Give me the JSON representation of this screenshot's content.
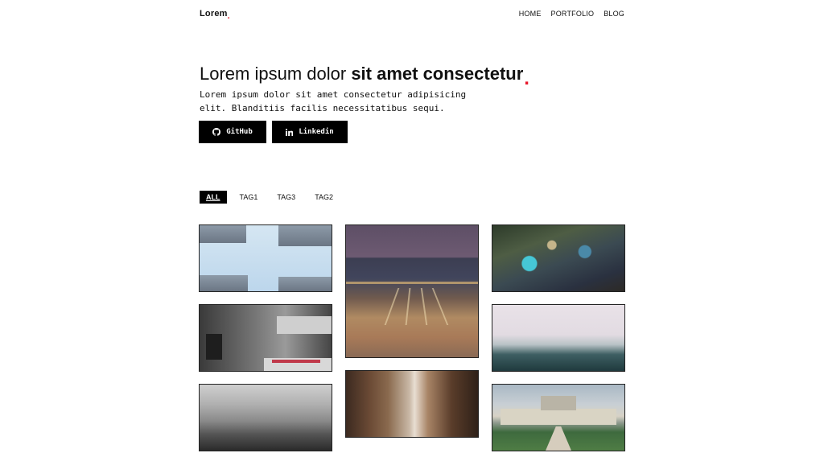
{
  "nav": {
    "brand": "Lorem.",
    "brand_text": "Lorem",
    "brand_dot": ".",
    "items": [
      "HOME",
      "PORTFOLIO",
      "BLOG"
    ]
  },
  "hero": {
    "title_regular": "Lorem ipsum dolor ",
    "title_bold": "sit amet consectetur",
    "title_dot": ".",
    "subtitle": "Lorem ipsum dolor sit amet consectetur adipisicing elit. Blanditiis facilis necessitatibus sequi.",
    "buttons": [
      {
        "label": "GitHub",
        "icon": "github-icon"
      },
      {
        "label": "Linkedin",
        "icon": "linkedin-icon"
      }
    ]
  },
  "filters": {
    "tags": [
      "ALL",
      "TAG1",
      "TAG3",
      "TAG2"
    ],
    "active": "ALL"
  },
  "gallery": {
    "photos": [
      {
        "subject": "skyscrapers-looking-up"
      },
      {
        "subject": "railway-night-city"
      },
      {
        "subject": "floating-market"
      },
      {
        "subject": "old-building-with-car"
      },
      {
        "subject": "misty-forest-coast"
      },
      {
        "subject": "fire-escapes-alley"
      },
      {
        "subject": "foggy-forest-bw"
      },
      {
        "subject": "chateau-avenue"
      }
    ]
  },
  "colors": {
    "accent": "#e8192c",
    "button_bg": "#000000",
    "text": "#111111"
  }
}
